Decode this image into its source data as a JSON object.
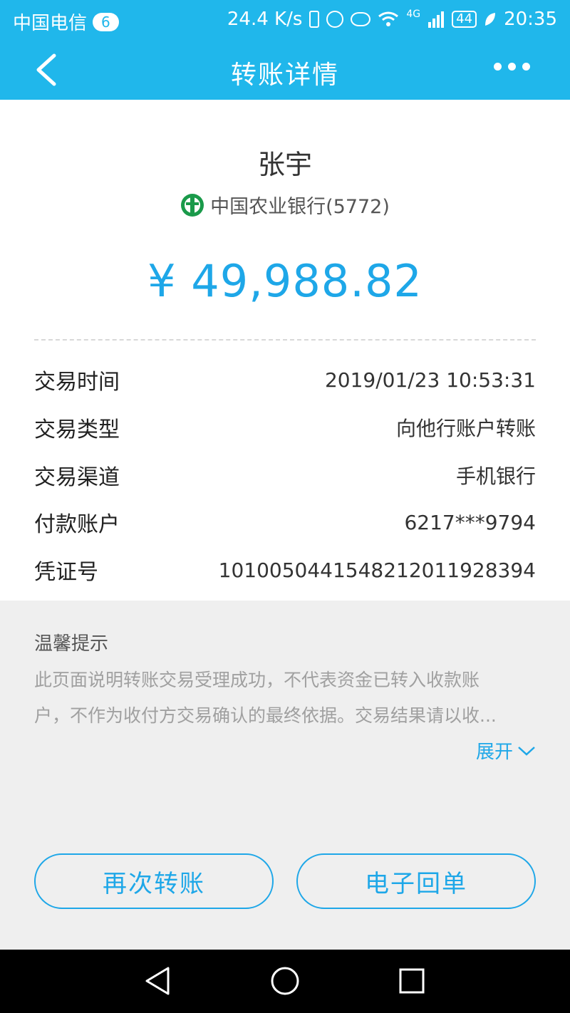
{
  "status_bar": {
    "carrier": "中国电信",
    "notification_count": "6",
    "network_speed": "24.4 K/s",
    "network_type": "4G",
    "battery": "44",
    "time": "20:35"
  },
  "app_bar": {
    "title": "转账详情",
    "back_icon": "chevron-left-icon",
    "more_icon": "more-horizontal-icon"
  },
  "transfer": {
    "payee_name": "张宇",
    "bank_name": "中国农业银行(5772)",
    "bank_icon": "abc-bank-logo",
    "amount": "¥ 49,988.82"
  },
  "details": [
    {
      "label": "交易时间",
      "value": "2019/01/23  10:53:31"
    },
    {
      "label": "交易类型",
      "value": "向他行账户转账"
    },
    {
      "label": "交易渠道",
      "value": "手机银行"
    },
    {
      "label": "付款账户",
      "value": "6217***9794"
    },
    {
      "label": "凭证号",
      "value": "1010050441548212011928394"
    }
  ],
  "tips": {
    "heading": "温馨提示",
    "line1": "此页面说明转账交易受理成功，不代表资金已转入收款账",
    "line2": "户，不作为收付方交易确认的最终依据。交易结果请以收...",
    "expand_label": "展开"
  },
  "buttons": {
    "transfer_again": "再次转账",
    "e_receipt": "电子回单"
  },
  "colors": {
    "header_blue": "#20b7eb",
    "accent_blue": "#1ea7e8",
    "bank_green": "#1a9a4a"
  }
}
